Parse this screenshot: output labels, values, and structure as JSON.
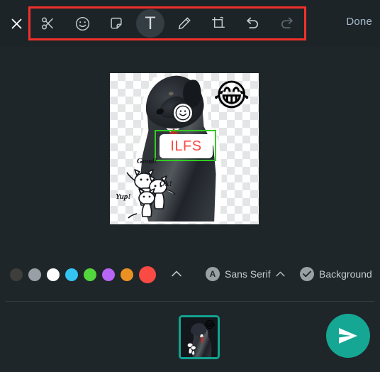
{
  "app": {
    "background_color": "#1f262a",
    "toolbar_background": "#1d2428",
    "accent_teal": "#15a794",
    "highlight_box_color": "#f2302b"
  },
  "toolbar": {
    "close_label": "✕",
    "done_label": "Done",
    "tools": [
      {
        "name": "scissors-icon",
        "label": "Cut",
        "selected": false,
        "disabled": false
      },
      {
        "name": "emoji-icon",
        "label": "Emoji",
        "selected": false,
        "disabled": false
      },
      {
        "name": "sticker-icon",
        "label": "Sticker",
        "selected": false,
        "disabled": false
      },
      {
        "name": "text-icon",
        "label": "T",
        "selected": true,
        "disabled": false
      },
      {
        "name": "pencil-icon",
        "label": "Draw",
        "selected": false,
        "disabled": false
      },
      {
        "name": "crop-icon",
        "label": "Crop",
        "selected": false,
        "disabled": false
      },
      {
        "name": "undo-icon",
        "label": "Undo",
        "selected": false,
        "disabled": false
      },
      {
        "name": "redo-icon",
        "label": "Redo",
        "selected": false,
        "disabled": true
      }
    ]
  },
  "canvas": {
    "transparency_checker": true,
    "checker_light": "#ffffff",
    "checker_dark": "#e3e5e6",
    "emoji_sticker": "😂",
    "smiley_sticker": "☺",
    "text_overlay": {
      "value": "ILFS",
      "text_color": "#fa4a42",
      "background_color": "#ffffff",
      "selection_border_color": "#33cc22",
      "selected": true
    },
    "doodle_words": [
      "Good!",
      "Ok!",
      "Yup!"
    ]
  },
  "options": {
    "colors": [
      {
        "name": "dark-gray",
        "hex": "#3e3e3c",
        "selected": false
      },
      {
        "name": "gray",
        "hex": "#98a0a6",
        "selected": false
      },
      {
        "name": "white",
        "hex": "#ffffff",
        "selected": false
      },
      {
        "name": "cyan",
        "hex": "#35c3f2",
        "selected": false
      },
      {
        "name": "green",
        "hex": "#52d53d",
        "selected": false
      },
      {
        "name": "purple",
        "hex": "#b765f5",
        "selected": false
      },
      {
        "name": "orange",
        "hex": "#eb9123",
        "selected": false
      },
      {
        "name": "red",
        "hex": "#f94a44",
        "selected": true
      }
    ],
    "expand_colors_label": "⌃",
    "font_icon_label": "A",
    "font_name": "Sans Serif",
    "font_chevron": "⌃",
    "background_toggle_label": "Background",
    "background_toggle_checked": true
  },
  "bottom": {
    "thumbnail_selected": true,
    "thumbnail_border_color": "#11a391",
    "thumbnail_emoji": "😂",
    "send_button_label": "send"
  }
}
